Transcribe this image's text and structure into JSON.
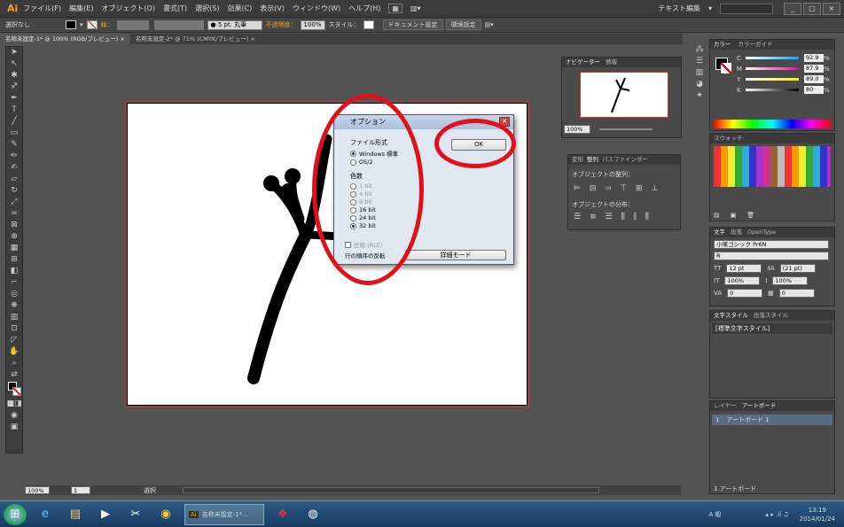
{
  "app": {
    "logo": "Ai",
    "mode_label": "テキスト編集",
    "window_buttons": [
      "_",
      "□",
      "×"
    ]
  },
  "menu": [
    "ファイル(F)",
    "編集(E)",
    "オブジェクト(O)",
    "書式(T)",
    "選択(S)",
    "効果(C)",
    "表示(V)",
    "ウィンドウ(W)",
    "ヘルプ(H)"
  ],
  "control": {
    "selection": "選択なし",
    "stroke_label": "線：",
    "brush": "● 5 pt. 丸筆",
    "opacity_label": "不透明度：",
    "opacity": "100%",
    "style_label": "スタイル：",
    "doc_setup": "ドキュメント設定",
    "env_setup": "環境設定"
  },
  "doc_tabs": [
    "名称未設定-1* @ 100% (RGB/プレビュー)  ×",
    "名称未設定-2* @ 71% (CMYK/プレビュー)  ×"
  ],
  "dialog": {
    "title": "オプション",
    "format_label": "ファイル形式",
    "formats": [
      {
        "label": "Windows 標準",
        "on": true
      },
      {
        "label": "OS/2",
        "on": false
      }
    ],
    "depth_label": "色数",
    "depths": [
      {
        "label": "1 bit",
        "on": false,
        "dis": true
      },
      {
        "label": "4 bit",
        "on": false,
        "dis": true
      },
      {
        "label": "8 bit",
        "on": false,
        "dis": true
      },
      {
        "label": "16 bit",
        "on": false,
        "dis": false
      },
      {
        "label": "24 bit",
        "on": false,
        "dis": false
      },
      {
        "label": "32 bit",
        "on": true,
        "dis": false
      }
    ],
    "compress_label": "圧縮 (RLE)",
    "row_order_label": "行の順序の反転",
    "ok": "OK",
    "advanced": "詳細モード"
  },
  "navigator": {
    "tabs": [
      "ナビゲーター",
      "情報"
    ],
    "zoom": "100%"
  },
  "align": {
    "tabs": [
      "変形",
      "整列",
      "パスファインダー"
    ],
    "objects_label": "オブジェクトの整列：",
    "distribute_label": "オブジェクトの分布："
  },
  "color": {
    "tabs": [
      "カラー",
      "カラーガイド"
    ],
    "channels": [
      {
        "k": "C",
        "v": "92.9"
      },
      {
        "k": "M",
        "v": "87.9"
      },
      {
        "k": "Y",
        "v": "89.0"
      },
      {
        "k": "K",
        "v": "80"
      }
    ],
    "pct": "%"
  },
  "swatch": {
    "tab": "スウォッチ"
  },
  "char": {
    "tabs": [
      "文字",
      "段落",
      "OpenType"
    ],
    "font": "小塚ゴシック Pr6N",
    "style": "R",
    "size": "12 pt",
    "leading": "(21 pt)",
    "vscale": "100%",
    "hscale": "100%",
    "tracking": "0",
    "kerning": "0"
  },
  "charstyle": {
    "tabs": [
      "文字スタイル",
      "段落スタイル"
    ],
    "item": "[標準文字スタイル]"
  },
  "layers": {
    "tabs": [
      "レイヤー",
      "アートボード"
    ],
    "row_num": "1",
    "row_name": "アートボード 1",
    "footer": "1 アートボード"
  },
  "status": {
    "zoom": "100%",
    "page": "1",
    "mode": "選択"
  },
  "taskbar": {
    "app_item": "名称未設定-1*...",
    "time": "13:19",
    "date": "2014/01/24",
    "ime": "A 般"
  },
  "colors": {
    "accent_red": "#e0111a",
    "ai_orange": "#f7a21a"
  }
}
